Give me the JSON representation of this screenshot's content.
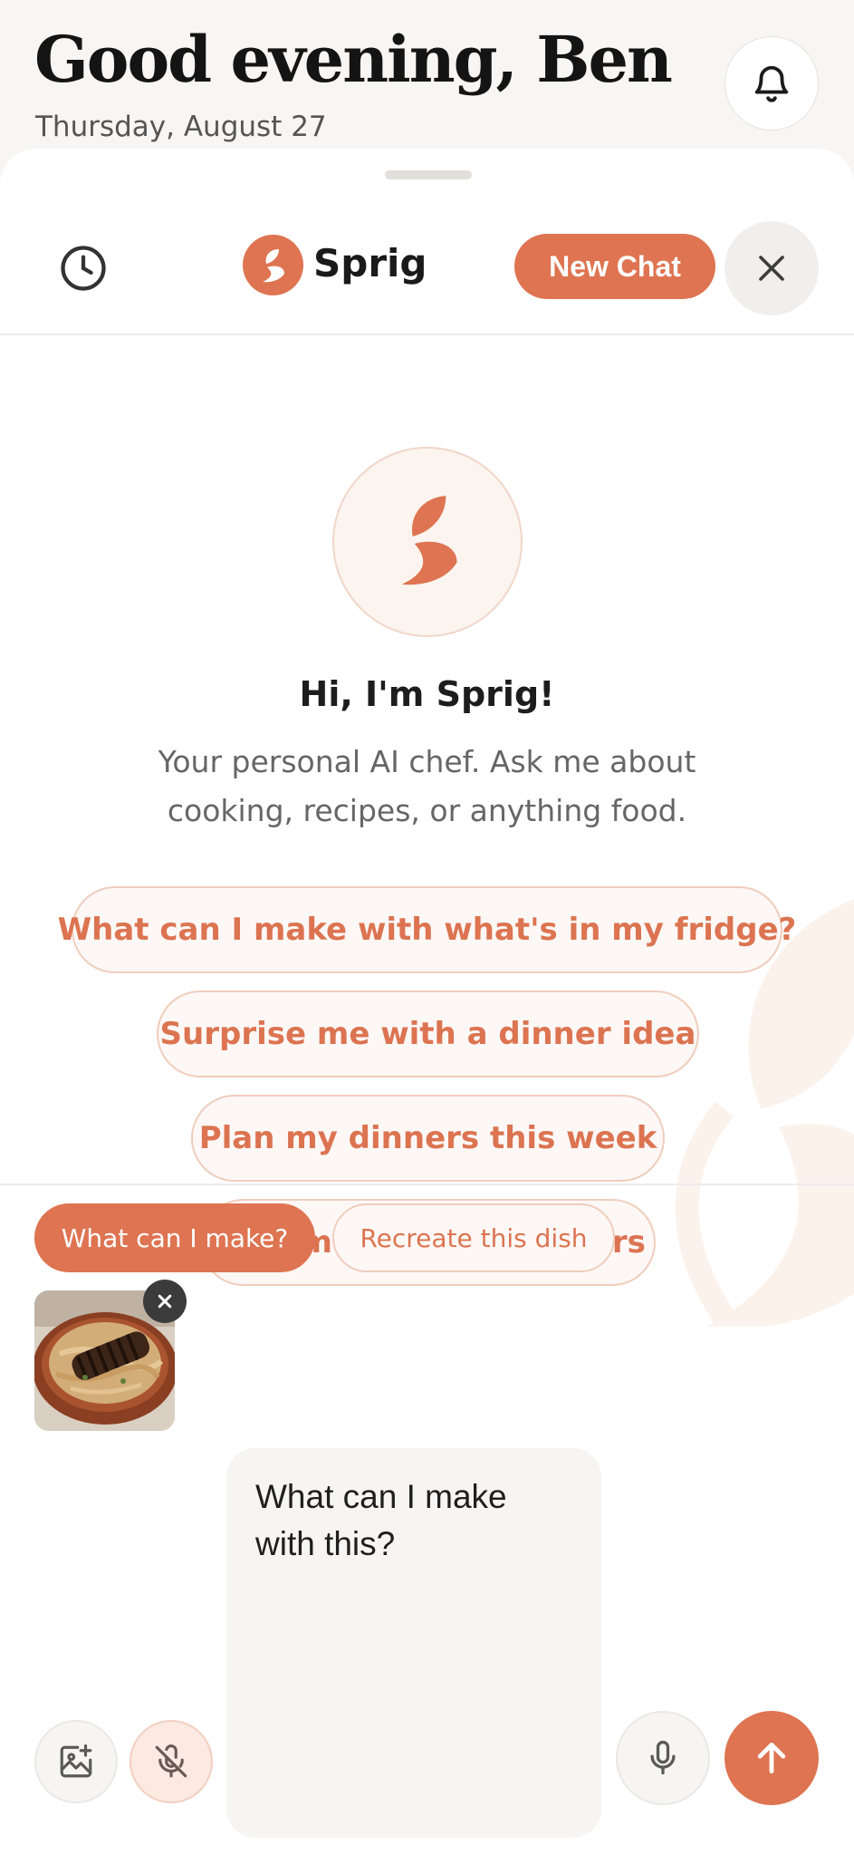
{
  "header": {
    "greeting": "Good evening, Ben",
    "date": "Thursday, August 27",
    "bell_icon": "bell-icon"
  },
  "chat_header": {
    "history_icon": "clock-icon",
    "brand_name": "Sprig",
    "new_chat_label": "New Chat",
    "close_icon": "close-icon"
  },
  "welcome": {
    "title": "Hi, I'm Sprig!",
    "subtitle": "Your personal AI chef. Ask me about cooking, recipes, or anything food."
  },
  "suggestions": [
    {
      "label": "What can I make with what's in my fridge?"
    },
    {
      "label": "Surprise me with a dinner idea"
    },
    {
      "label": "Plan my dinners this week"
    },
    {
      "label": "Help me use up leftovers"
    }
  ],
  "quick_chips": [
    {
      "label": "What can I make?",
      "selected": true
    },
    {
      "label": "Recreate this dish",
      "selected": false
    }
  ],
  "attachment": {
    "remove_icon": "close-icon"
  },
  "composer": {
    "message": "What can I make with this?",
    "image_icon": "image-add-icon",
    "mic_off_icon": "mic-off-icon",
    "mic_icon": "mic-icon",
    "send_icon": "arrow-up-icon"
  },
  "colors": {
    "accent": "#de7451",
    "accent_border": "#f0cdbd",
    "background": "#f7f6f4"
  }
}
